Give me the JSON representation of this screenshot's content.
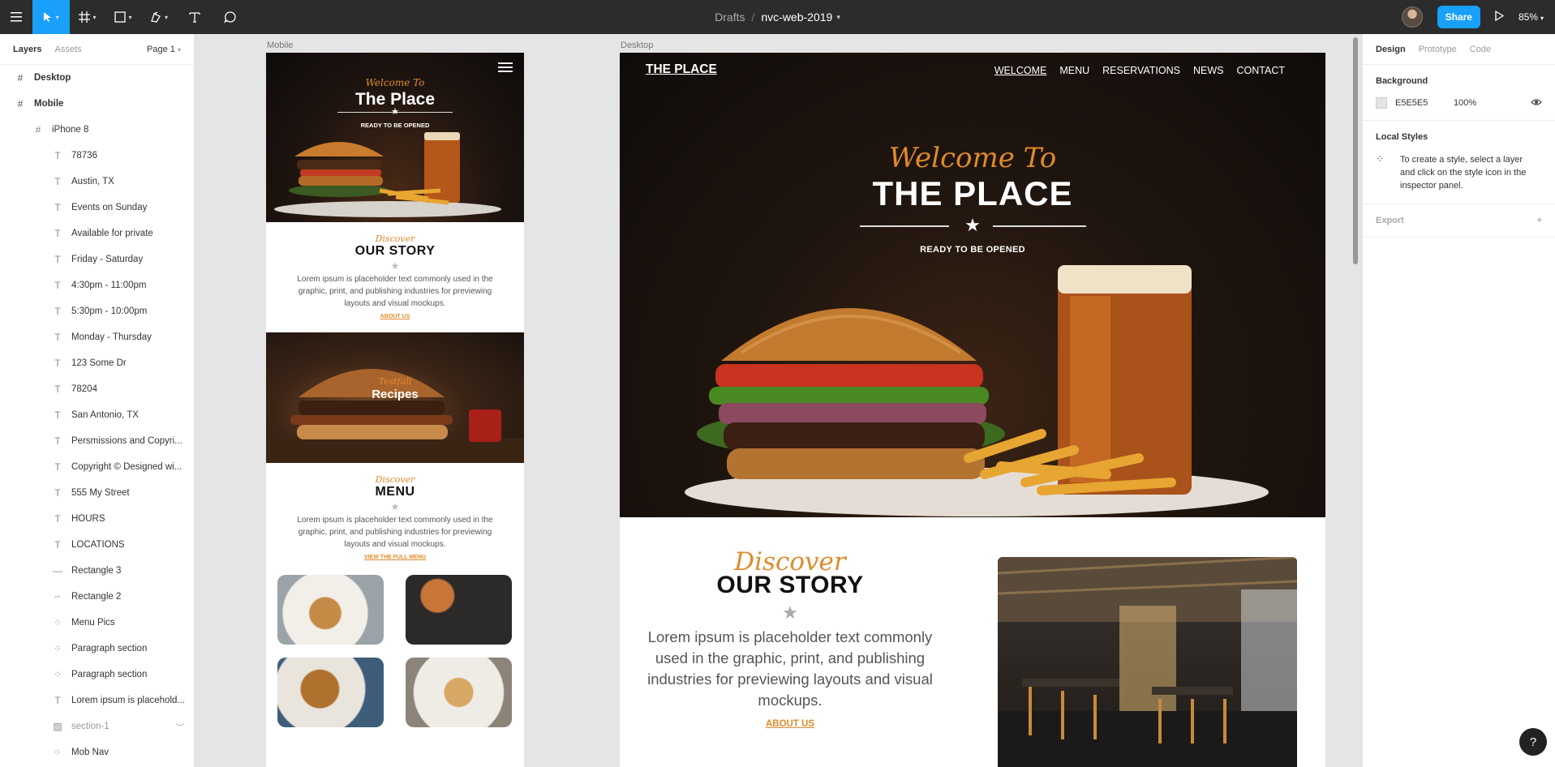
{
  "toolbar": {
    "breadcrumb_folder": "Drafts",
    "breadcrumb_sep": "/",
    "file_name": "nvc-web-2019",
    "share_label": "Share",
    "zoom": "85%",
    "icons": [
      "hamburger-menu-icon",
      "move-tool-icon",
      "frame-tool-icon",
      "shape-tool-icon",
      "pen-tool-icon",
      "text-tool-icon",
      "comment-tool-icon",
      "play-icon"
    ]
  },
  "left_panel": {
    "tabs": [
      "Layers",
      "Assets"
    ],
    "page": "Page 1",
    "layers": [
      {
        "name": "Desktop",
        "icon": "#",
        "level": 0
      },
      {
        "name": "Mobile",
        "icon": "#",
        "level": 0
      },
      {
        "name": "iPhone 8",
        "icon": "#",
        "level": 1
      },
      {
        "name": "78736",
        "icon": "T",
        "level": 2
      },
      {
        "name": "Austin, TX",
        "icon": "T",
        "level": 2
      },
      {
        "name": "Events on Sunday",
        "icon": "T",
        "level": 2
      },
      {
        "name": "Available for private",
        "icon": "T",
        "level": 2
      },
      {
        "name": "Friday - Saturday",
        "icon": "T",
        "level": 2
      },
      {
        "name": "4:30pm - 11:00pm",
        "icon": "T",
        "level": 2
      },
      {
        "name": "5:30pm - 10:00pm",
        "icon": "T",
        "level": 2
      },
      {
        "name": "Monday - Thursday",
        "icon": "T",
        "level": 2
      },
      {
        "name": "123 Some Dr",
        "icon": "T",
        "level": 2
      },
      {
        "name": "78204",
        "icon": "T",
        "level": 2
      },
      {
        "name": "San Antonio, TX",
        "icon": "T",
        "level": 2
      },
      {
        "name": "Persmissions and Copyri...",
        "icon": "T",
        "level": 2
      },
      {
        "name": "Copyright © Designed wi...",
        "icon": "T",
        "level": 2
      },
      {
        "name": "555 My Street",
        "icon": "T",
        "level": 2
      },
      {
        "name": "HOURS",
        "icon": "T",
        "level": 2
      },
      {
        "name": "LOCATIONS",
        "icon": "T",
        "level": 2
      },
      {
        "name": "Rectangle 3",
        "icon": "—",
        "level": 2
      },
      {
        "name": "Rectangle 2",
        "icon": "┄",
        "level": 2
      },
      {
        "name": "Menu Pics",
        "icon": "⁘",
        "level": 2
      },
      {
        "name": "Paragraph section",
        "icon": "⁘",
        "level": 2
      },
      {
        "name": "Paragraph section",
        "icon": "⁘",
        "level": 2
      },
      {
        "name": "Lorem ipsum is placehold...",
        "icon": "T",
        "level": 2
      },
      {
        "name": "section-1",
        "icon": "▨",
        "level": 2,
        "hidden": true
      },
      {
        "name": "Mob Nav",
        "icon": "⁘",
        "level": 2
      }
    ]
  },
  "canvas": {
    "mobile_label": "Mobile",
    "desktop_label": "Desktop"
  },
  "mobile": {
    "welcome": "Welcome To",
    "title": "The Place",
    "star": "★",
    "ready": "READY TO BE OPENED",
    "story_discover": "Discover",
    "story_title": "OUR STORY",
    "story_text": "Lorem ipsum is placeholder text commonly used in the graphic, print, and publishing industries for previewing layouts and visual mockups.",
    "story_link": "ABOUT US",
    "recipes_discover": "Testfall",
    "recipes_title": "Recipes",
    "menu_discover": "Discover",
    "menu_title": "MENU",
    "menu_text": "Lorem ipsum is placeholder text commonly used in the graphic, print, and publishing industries for previewing layouts and visual mockups.",
    "menu_link": "VIEW THE FULL MENU"
  },
  "desktop": {
    "logo": "THE PLACE",
    "nav": [
      "WELCOME",
      "MENU",
      "RESERVATIONS",
      "NEWS",
      "CONTACT"
    ],
    "welcome": "Welcome To",
    "title": "THE PLACE",
    "star": "★",
    "ready": "READY TO BE OPENED",
    "story_discover": "Discover",
    "story_title": "OUR STORY",
    "story_text": "Lorem ipsum is placeholder text commonly used in the graphic, print, and publishing industries for previewing layouts and visual mockups.",
    "story_link": "ABOUT US"
  },
  "right_panel": {
    "tabs": [
      "Design",
      "Prototype",
      "Code"
    ],
    "background_label": "Background",
    "background_hex": "E5E5E5",
    "background_opacity": "100%",
    "local_styles_label": "Local Styles",
    "local_styles_hint": "To create a style, select a layer and click on the style icon in the inspector panel.",
    "export_label": "Export",
    "export_add": "+"
  },
  "help_label": "?",
  "colors": {
    "accent": "#18a0fb",
    "toolbar": "#2c2c2c",
    "brand_orange": "#e08a2b",
    "canvas": "#e5e5e5"
  }
}
